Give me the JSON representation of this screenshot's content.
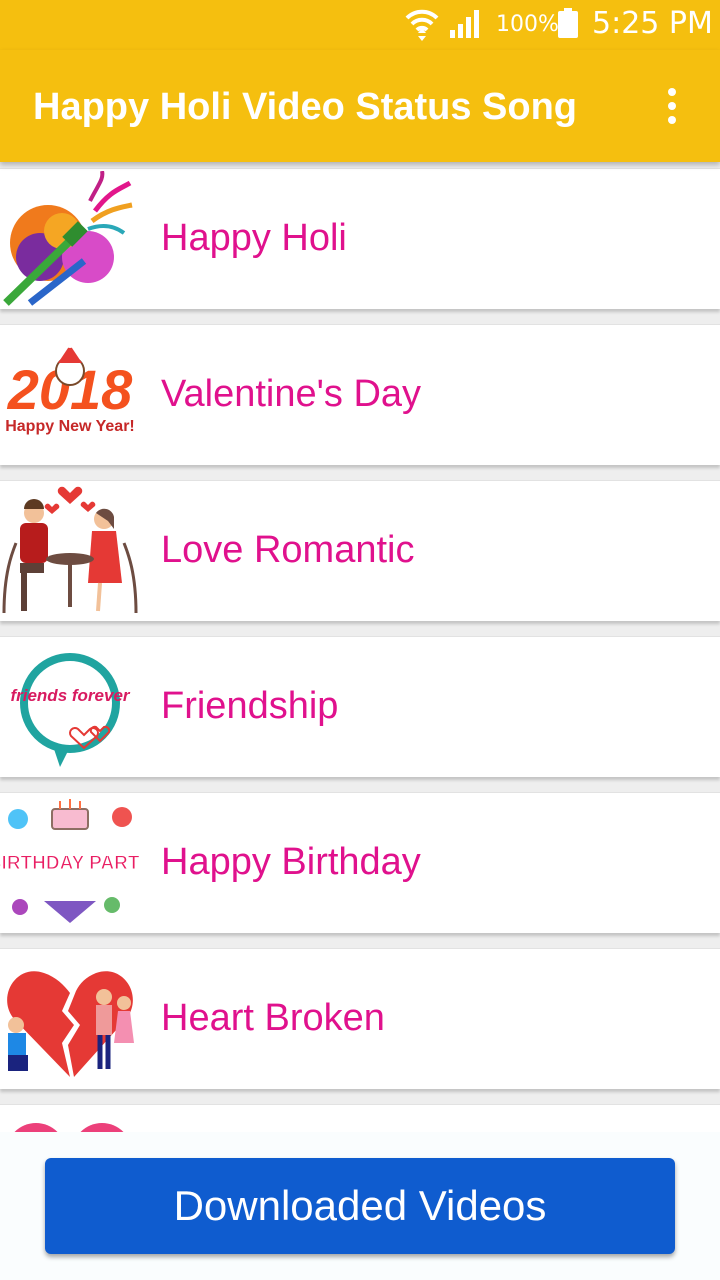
{
  "status_bar": {
    "battery_percent": "100%",
    "time": "5:25 PM",
    "icons": [
      "wifi-icon",
      "signal-icon",
      "battery-icon"
    ]
  },
  "app_bar": {
    "title": "Happy Holi Video Status Song",
    "menu_icon": "overflow-menu-icon"
  },
  "categories": [
    {
      "label": "Happy Holi",
      "icon": "holi-colors-icon"
    },
    {
      "label": "Valentine's Day",
      "icon": "new-year-2018-icon",
      "icon_text": "2018",
      "icon_subtext": "Happy New Year!"
    },
    {
      "label": "Love Romantic",
      "icon": "romantic-couple-icon"
    },
    {
      "label": "Friendship",
      "icon": "friends-forever-icon",
      "icon_text": "friends forever"
    },
    {
      "label": "Happy Birthday",
      "icon": "birthday-party-icon",
      "icon_text": "BIRTHDAY PARTY"
    },
    {
      "label": "Heart Broken",
      "icon": "broken-heart-icon"
    }
  ],
  "bottom": {
    "button_label": "Downloaded Videos"
  },
  "colors": {
    "app_bar": "#f5bf0f",
    "label_text": "#e0118d",
    "button": "#0f5ccf"
  }
}
